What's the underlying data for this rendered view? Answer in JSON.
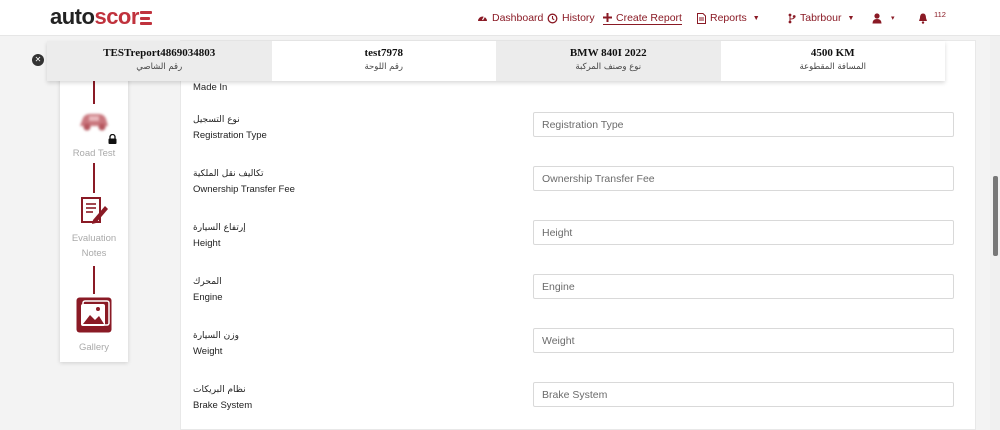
{
  "brand": {
    "part1": "auto",
    "part2": "scor",
    "accent": "#c0323d"
  },
  "nav": {
    "dashboard": "Dashboard",
    "history": "History",
    "create_report": "Create Report",
    "reports": "Reports",
    "user": "Tabrbour",
    "notification_count": "112"
  },
  "summary": [
    {
      "value": "TESTreport4869034803",
      "label": "رقم الشاصي"
    },
    {
      "value": "test7978",
      "label": "رقم اللوحة"
    },
    {
      "value": "BMW 840I 2022",
      "label": "نوع وصنف المركبة"
    },
    {
      "value": "4500 KM",
      "label": "المسافة المقطوعة"
    }
  ],
  "steps": [
    {
      "label": "Road Test",
      "icon": "car-icon",
      "locked": true
    },
    {
      "label_line1": "Evaluation",
      "label_line2": "Notes",
      "icon": "notes-icon"
    },
    {
      "label": "Gallery",
      "icon": "gallery-icon"
    }
  ],
  "form": {
    "made_in": {
      "label_en": "Made In"
    },
    "fields": [
      {
        "label_ar": "نوع التسجيل",
        "label_en": "Registration Type",
        "placeholder": "Registration Type"
      },
      {
        "label_ar": "تكاليف نقل الملكية",
        "label_en": "Ownership Transfer Fee",
        "placeholder": "Ownership Transfer Fee"
      },
      {
        "label_ar": "إرتفاع السيارة",
        "label_en": "Height",
        "placeholder": "Height"
      },
      {
        "label_ar": "المحرك",
        "label_en": "Engine",
        "placeholder": "Engine"
      },
      {
        "label_ar": "وزن السيارة",
        "label_en": "Weight",
        "placeholder": "Weight"
      },
      {
        "label_ar": "نظام البريكات",
        "label_en": "Brake System",
        "placeholder": "Brake System"
      }
    ]
  },
  "colors": {
    "primary": "#8a1a25",
    "accent": "#c0323d"
  }
}
